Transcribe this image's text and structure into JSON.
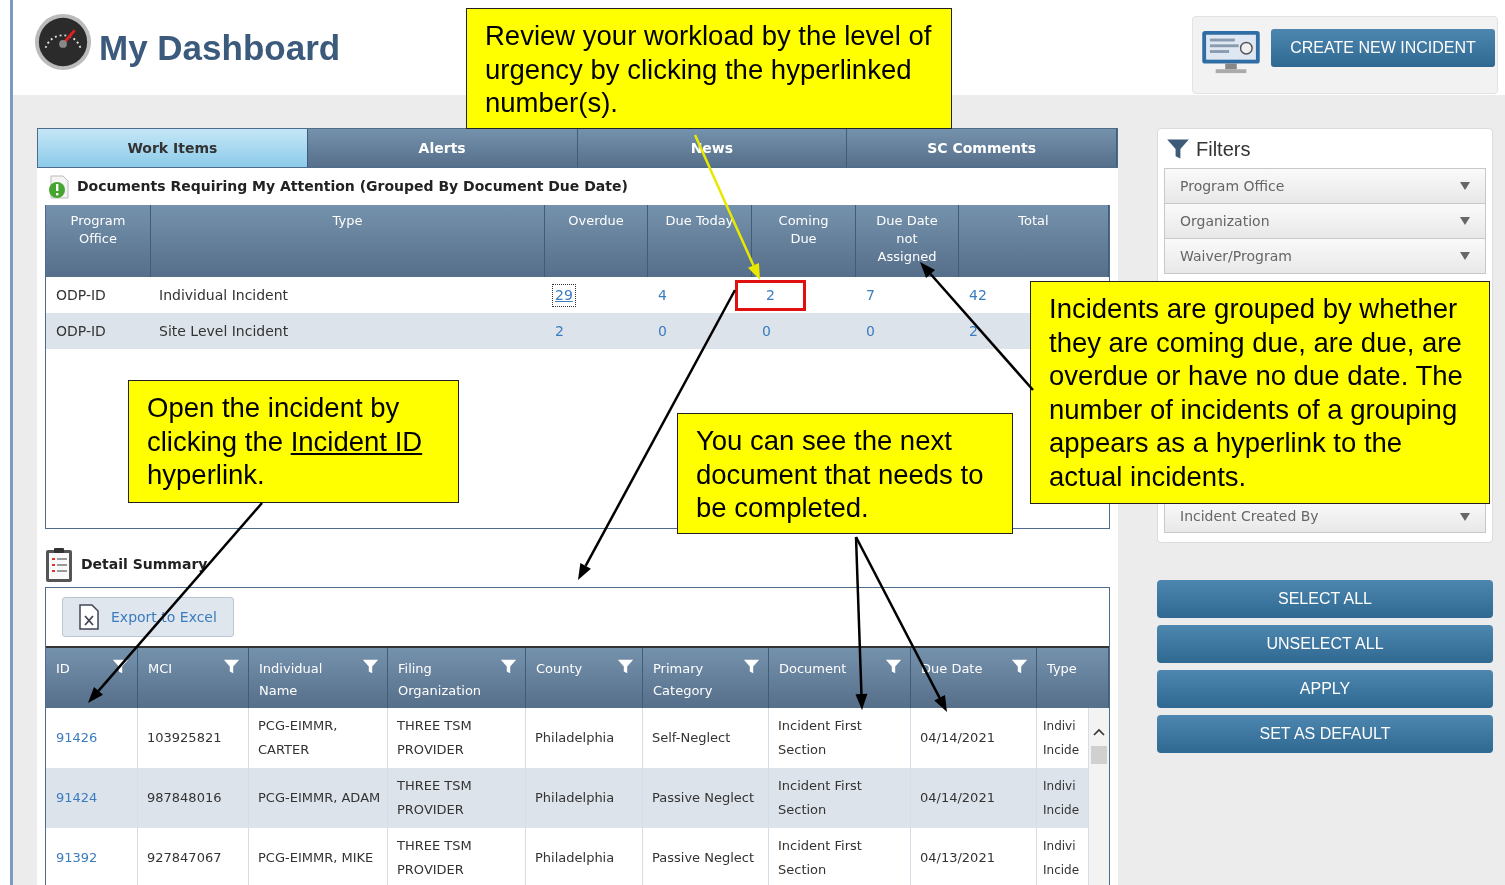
{
  "header": {
    "title": "My Dashboard",
    "create_button": "CREATE NEW INCIDENT"
  },
  "tabs": [
    {
      "label": "Work Items",
      "selected": true
    },
    {
      "label": "Alerts",
      "selected": false
    },
    {
      "label": "News",
      "selected": false
    },
    {
      "label": "SC Comments",
      "selected": false
    }
  ],
  "summary": {
    "title": "Documents Requiring My Attention (Grouped By Document Due Date)",
    "columns": [
      "Program Office",
      "Type",
      "Overdue",
      "Due Today",
      "Coming Due",
      "Due Date not Assigned",
      "Total"
    ],
    "rows": [
      {
        "program_office": "ODP-ID",
        "type": "Individual Incident",
        "counts": [
          {
            "value": "29",
            "focused": true,
            "highlighted": false
          },
          {
            "value": "4",
            "focused": false,
            "highlighted": false
          },
          {
            "value": "2",
            "focused": false,
            "highlighted": true
          },
          {
            "value": "7",
            "focused": false,
            "highlighted": false
          },
          {
            "value": "42",
            "focused": false,
            "highlighted": false
          }
        ]
      },
      {
        "program_office": "ODP-ID",
        "type": "Site Level Incident",
        "counts": [
          {
            "value": "2",
            "focused": false,
            "highlighted": false
          },
          {
            "value": "0",
            "focused": false,
            "highlighted": false
          },
          {
            "value": "0",
            "focused": false,
            "highlighted": false
          },
          {
            "value": "0",
            "focused": false,
            "highlighted": false
          },
          {
            "value": "2",
            "focused": false,
            "highlighted": false
          }
        ]
      }
    ]
  },
  "detail": {
    "title": "Detail Summary",
    "export_button": "Export to Excel",
    "columns": [
      {
        "label": "ID",
        "filter": true
      },
      {
        "label": "MCI",
        "filter": true
      },
      {
        "label": "Individual Name",
        "filter": true
      },
      {
        "label": "Filing Organization",
        "filter": true
      },
      {
        "label": "County",
        "filter": true
      },
      {
        "label": "Primary Category",
        "filter": true
      },
      {
        "label": "Document",
        "filter": true
      },
      {
        "label": "Due Date",
        "filter": true
      },
      {
        "label": "Type",
        "filter": false
      }
    ],
    "rows": [
      {
        "cells": [
          "91426",
          "103925821",
          "PCG-EIMMR, CARTER",
          "THREE TSM PROVIDER",
          "Philadelphia",
          "Self-Neglect",
          "Incident First Section",
          "04/14/2021",
          "Indivi Incide"
        ]
      },
      {
        "cells": [
          "91424",
          "987848016",
          "PCG-EIMMR, ADAM",
          "THREE TSM PROVIDER",
          "Philadelphia",
          "Passive Neglect",
          "Incident First Section",
          "04/14/2021",
          "Indivi Incide"
        ]
      },
      {
        "cells": [
          "91392",
          "927847067",
          "PCG-EIMMR, MIKE",
          "THREE TSM PROVIDER",
          "Philadelphia",
          "Passive Neglect",
          "Incident First Section",
          "04/13/2021",
          "Indivi Incide"
        ]
      }
    ]
  },
  "filters": {
    "title": "Filters",
    "dropdowns": [
      "Program Office",
      "Organization",
      "Waiver/Program"
    ],
    "dropdowns_below": [
      "Incident Created By"
    ]
  },
  "actions": [
    "SELECT ALL",
    "UNSELECT ALL",
    "APPLY",
    "SET AS DEFAULT"
  ],
  "callouts": [
    {
      "segments": [
        {
          "kind": "text",
          "text": "Review your workload by the level of urgency by clicking the hyperlinked number(s)."
        }
      ]
    },
    {
      "segments": [
        {
          "kind": "text",
          "text": "Open the incident by clicking the "
        },
        {
          "kind": "link",
          "text": "Incident ID"
        },
        {
          "kind": "text",
          "text": " hyperlink."
        }
      ]
    },
    {
      "segments": [
        {
          "kind": "text",
          "text": "You can see the next document that needs to be completed."
        }
      ]
    },
    {
      "segments": [
        {
          "kind": "text",
          "text": "Incidents are grouped by whether they are coming due, are due, are overdue or have no due date. The number of incidents of a grouping appears as a hyperlink to the actual incidents."
        }
      ]
    }
  ]
}
